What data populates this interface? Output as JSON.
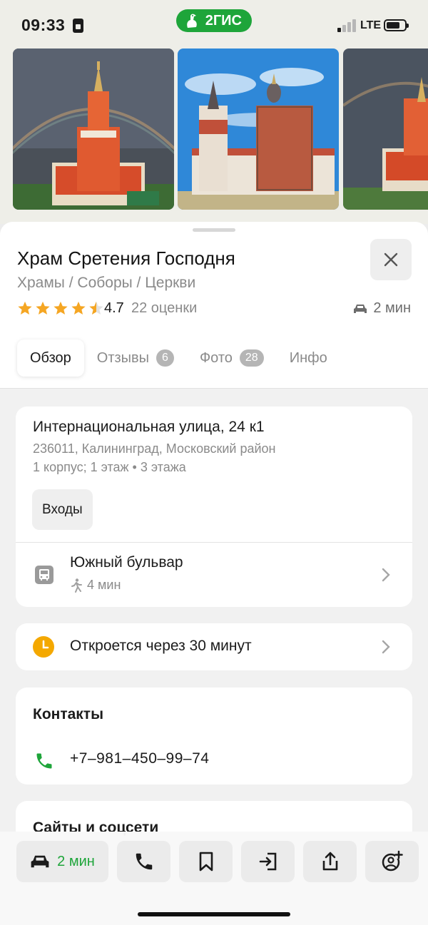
{
  "status_bar": {
    "time": "09:33",
    "network": "LTE",
    "battery_level": 0.75
  },
  "brand": {
    "name": "2ГИС"
  },
  "place": {
    "title": "Храм Сретения Господня",
    "category": "Храмы / Соборы / Церкви",
    "rating": "4.7",
    "rating_count": "22 оценки",
    "stars": 4.5,
    "drive_time": "2 мин"
  },
  "tabs": [
    {
      "label": "Обзор",
      "badge": null
    },
    {
      "label": "Отзывы",
      "badge": "6"
    },
    {
      "label": "Фото",
      "badge": "28"
    },
    {
      "label": "Инфо",
      "badge": null
    }
  ],
  "address": {
    "street": "Интернациональная улица, 24 к1",
    "city": "236011, Калининград, Московский район",
    "building": "1 корпус; 1 этаж • 3 этажа",
    "entrances_label": "Входы"
  },
  "transit": {
    "stop": "Южный бульвар",
    "walk_time": "4 мин"
  },
  "hours": {
    "status": "Откроется через 30 минут"
  },
  "contacts": {
    "title": "Контакты",
    "phone": "+7‒981‒450‒99‒74"
  },
  "sites": {
    "title": "Сайты и соцсети"
  },
  "actions": {
    "route_label": "2 мин"
  },
  "colors": {
    "accent": "#1ea53a",
    "star": "#f5a623",
    "clock": "#f4a800"
  },
  "icons": [
    "car-icon",
    "phone-icon",
    "bookmark-icon",
    "entrance-icon",
    "share-icon",
    "add-contact-icon",
    "bus-icon",
    "walk-icon",
    "clock-icon",
    "close-icon",
    "chevron-right-icon"
  ]
}
